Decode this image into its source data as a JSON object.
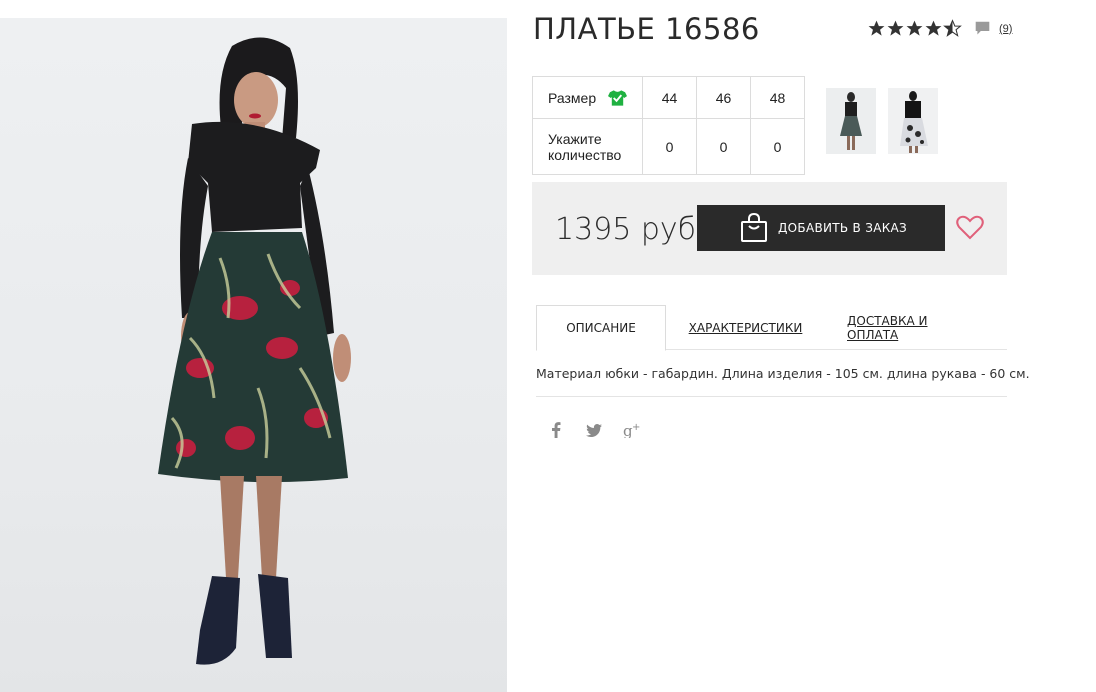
{
  "product": {
    "title": "ПЛАТЬЕ 16586",
    "rating_stars": 4.5,
    "reviews_count": "(9)"
  },
  "sizes": {
    "size_label": "Размер",
    "qty_label": "Укажите количество",
    "options": [
      "44",
      "46",
      "48"
    ],
    "quantities": [
      "0",
      "0",
      "0"
    ]
  },
  "price": {
    "value": "1395 руб",
    "add_button": "ДОБАВИТЬ В ЗАКАЗ"
  },
  "tabs": {
    "items": [
      "ОПИСАНИЕ",
      "ХАРАКТЕРИСТИКИ",
      "ДОСТАВКА И ОПЛАТА"
    ],
    "active": "ОПИСАНИЕ"
  },
  "description": "Материал юбки - габардин. Длина изделия - 105 см. длина рукава - 60 см.",
  "social": [
    "facebook-icon",
    "twitter-icon",
    "google-plus-icon"
  ],
  "colors": {
    "accent_green": "#1fb141",
    "button_dark": "#2a2a2a",
    "heart_pink": "#e0607a",
    "price_box_bg": "#efefef"
  }
}
